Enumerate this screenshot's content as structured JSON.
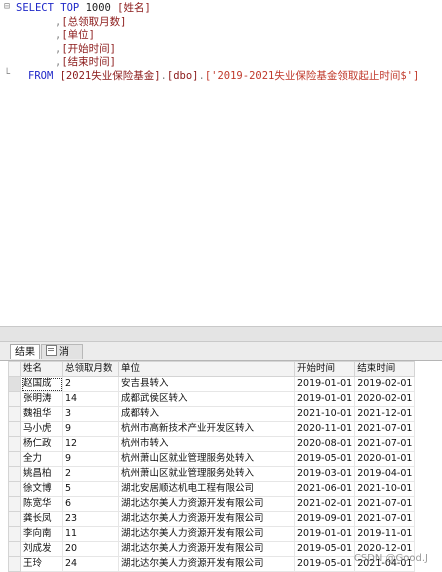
{
  "editor": {
    "lines": [
      {
        "gutter": "⊟",
        "parts": [
          [
            "kw",
            "SELECT "
          ],
          [
            "kw",
            "TOP "
          ],
          [
            "pl",
            "1000 "
          ],
          [
            "br",
            "[姓名]"
          ]
        ]
      },
      {
        "gutter": "",
        "parts": [
          [
            "gr",
            ","
          ],
          [
            "br",
            "[总领取月数]"
          ]
        ]
      },
      {
        "gutter": "",
        "parts": [
          [
            "gr",
            ","
          ],
          [
            "br",
            "[单位]"
          ]
        ]
      },
      {
        "gutter": "",
        "parts": [
          [
            "gr",
            ","
          ],
          [
            "br",
            "[开始时间]"
          ]
        ]
      },
      {
        "gutter": "",
        "parts": [
          [
            "gr",
            ","
          ],
          [
            "br",
            "[结束时间]"
          ]
        ]
      },
      {
        "gutter": "└",
        "parts": [
          [
            "kw",
            "FROM "
          ],
          [
            "br",
            "[2021失业保险基金]"
          ],
          [
            "gr",
            "."
          ],
          [
            "br",
            "[dbo]"
          ],
          [
            "gr",
            "."
          ],
          [
            "st",
            "['2019-2021失业保险基金领取起止时间$']"
          ]
        ]
      }
    ]
  },
  "tabs": {
    "results_label": "结果",
    "messages_label": "消息"
  },
  "grid": {
    "columns": [
      "姓名",
      "总领取月数",
      "单位",
      "开始时间",
      "结束时间"
    ],
    "rows": [
      [
        "赵国成",
        "2",
        "安吉县转入",
        "2019-01-01",
        "2019-02-01"
      ],
      [
        "张明涛",
        "14",
        "成都武侯区转入",
        "2019-01-01",
        "2020-02-01"
      ],
      [
        "魏祖华",
        "3",
        "成都转入",
        "2021-10-01",
        "2021-12-01"
      ],
      [
        "马小虎",
        "9",
        "杭州市高新技术产业开发区转入",
        "2020-11-01",
        "2021-07-01"
      ],
      [
        "杨仁政",
        "12",
        "杭州市转入",
        "2020-08-01",
        "2021-07-01"
      ],
      [
        "全力",
        "9",
        "杭州萧山区就业管理服务处转入",
        "2019-05-01",
        "2020-01-01"
      ],
      [
        "姚昌柏",
        "2",
        "杭州萧山区就业管理服务处转入",
        "2019-03-01",
        "2019-04-01"
      ],
      [
        "徐文博",
        "5",
        "湖北安居顺达机电工程有限公司",
        "2021-06-01",
        "2021-10-01"
      ],
      [
        "陈宽华",
        "6",
        "湖北达尔美人力资源开发有限公司",
        "2021-02-01",
        "2021-07-01"
      ],
      [
        "龚长凤",
        "23",
        "湖北达尔美人力资源开发有限公司",
        "2019-09-01",
        "2021-07-01"
      ],
      [
        "李向南",
        "11",
        "湖北达尔美人力资源开发有限公司",
        "2019-01-01",
        "2019-11-01"
      ],
      [
        "刘成发",
        "20",
        "湖北达尔美人力资源开发有限公司",
        "2019-05-01",
        "2020-12-01"
      ],
      [
        "王玲",
        "24",
        "湖北达尔美人力资源开发有限公司",
        "2019-05-01",
        "2021-04-01"
      ]
    ]
  },
  "watermark": "CSDN @Good.J"
}
